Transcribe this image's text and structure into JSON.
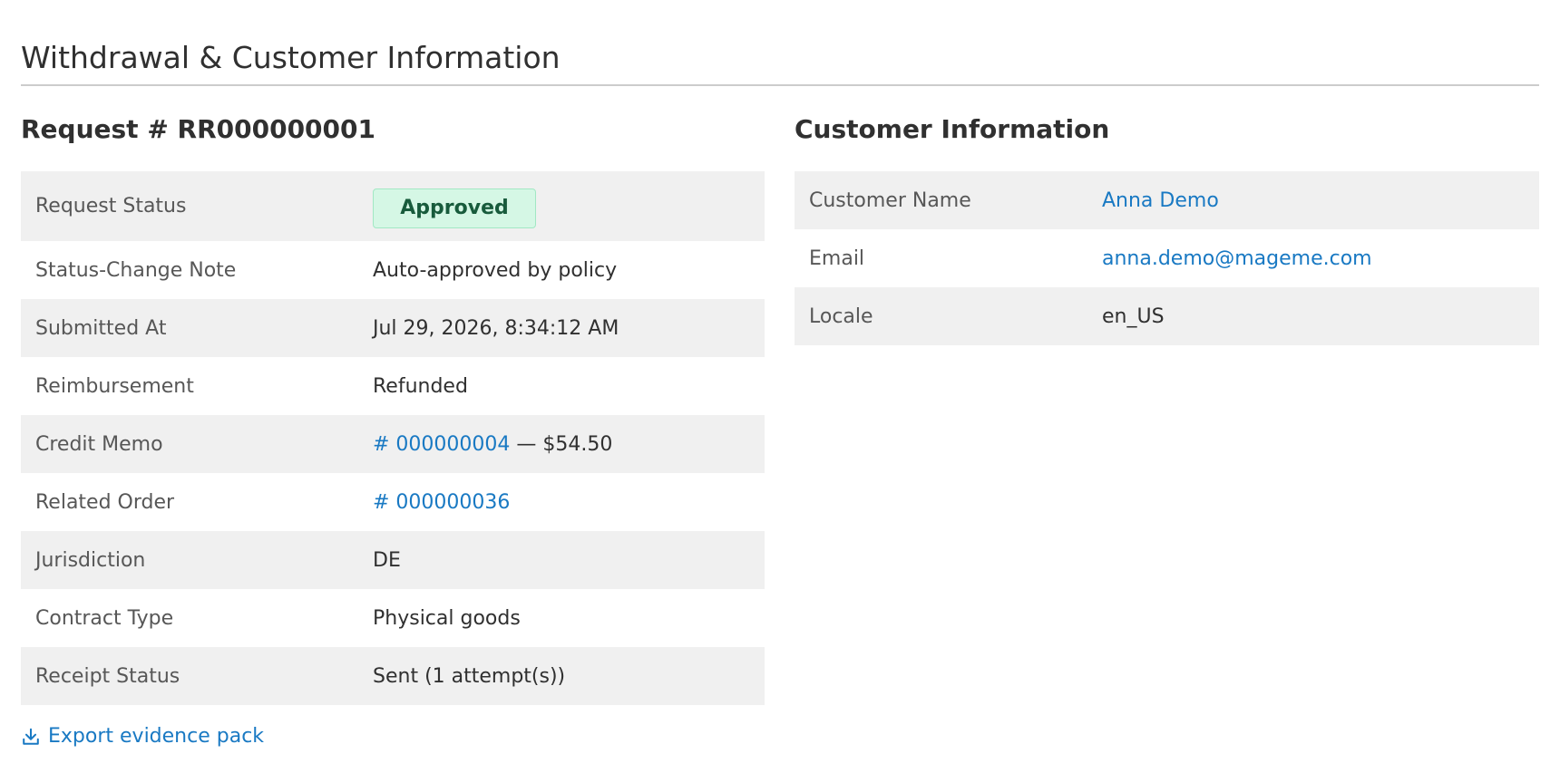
{
  "section": {
    "title": "Withdrawal & Customer Information"
  },
  "request": {
    "title": "Request # RR000000001",
    "rows": {
      "status": {
        "label": "Request Status",
        "value": "Approved"
      },
      "note": {
        "label": "Status-Change Note",
        "value": "Auto-approved by policy"
      },
      "submitted": {
        "label": "Submitted At",
        "value": "Jul 29, 2026, 8:34:12 AM"
      },
      "reimbursement": {
        "label": "Reimbursement",
        "value": "Refunded"
      },
      "credit_memo": {
        "label": "Credit Memo",
        "link": "# 000000004",
        "suffix": " — $54.50"
      },
      "order": {
        "label": "Related Order",
        "link": "# 000000036"
      },
      "jurisdiction": {
        "label": "Jurisdiction",
        "value": "DE"
      },
      "contract": {
        "label": "Contract Type",
        "value": "Physical goods"
      },
      "receipt": {
        "label": "Receipt Status",
        "value": "Sent (1 attempt(s))"
      }
    },
    "status_colors": {
      "badge_bg": "#d5f7e5",
      "badge_border": "#a2e8c4",
      "badge_text": "#185b3c"
    }
  },
  "customer": {
    "title": "Customer Information",
    "rows": {
      "name": {
        "label": "Customer Name",
        "value": "Anna Demo"
      },
      "email": {
        "label": "Email",
        "value": "anna.demo@mageme.com"
      },
      "locale": {
        "label": "Locale",
        "value": "en_US"
      }
    }
  },
  "actions": {
    "export_label": "Export evidence pack",
    "export_icon": "download-icon"
  },
  "colors": {
    "link": "#1979c3",
    "row_alt": "#f0f0f0"
  }
}
